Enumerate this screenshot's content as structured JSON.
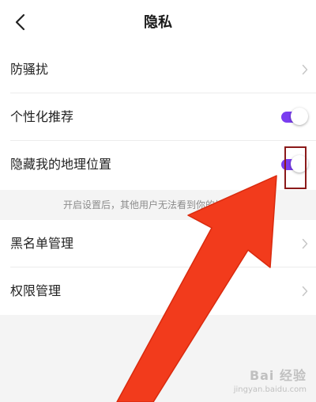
{
  "header": {
    "title": "隐私",
    "back_icon": "chevron-left-icon"
  },
  "settings": {
    "anti_harassment": {
      "label": "防骚扰"
    },
    "personalized_recommendation": {
      "label": "个性化推荐",
      "enabled": true
    },
    "hide_location": {
      "label": "隐藏我的地理位置",
      "enabled": true
    },
    "hide_location_hint": "开启设置后，其他用户无法看到你的地理位置",
    "blacklist": {
      "label": "黑名单管理"
    },
    "permissions": {
      "label": "权限管理"
    }
  },
  "colors": {
    "toggle_on": "#7a3df0",
    "annotation_arrow": "#f23b1c",
    "annotation_box": "#8b1a1a"
  },
  "watermark": {
    "main": "Bai 经验",
    "sub": "jingyan.baidu.com"
  }
}
